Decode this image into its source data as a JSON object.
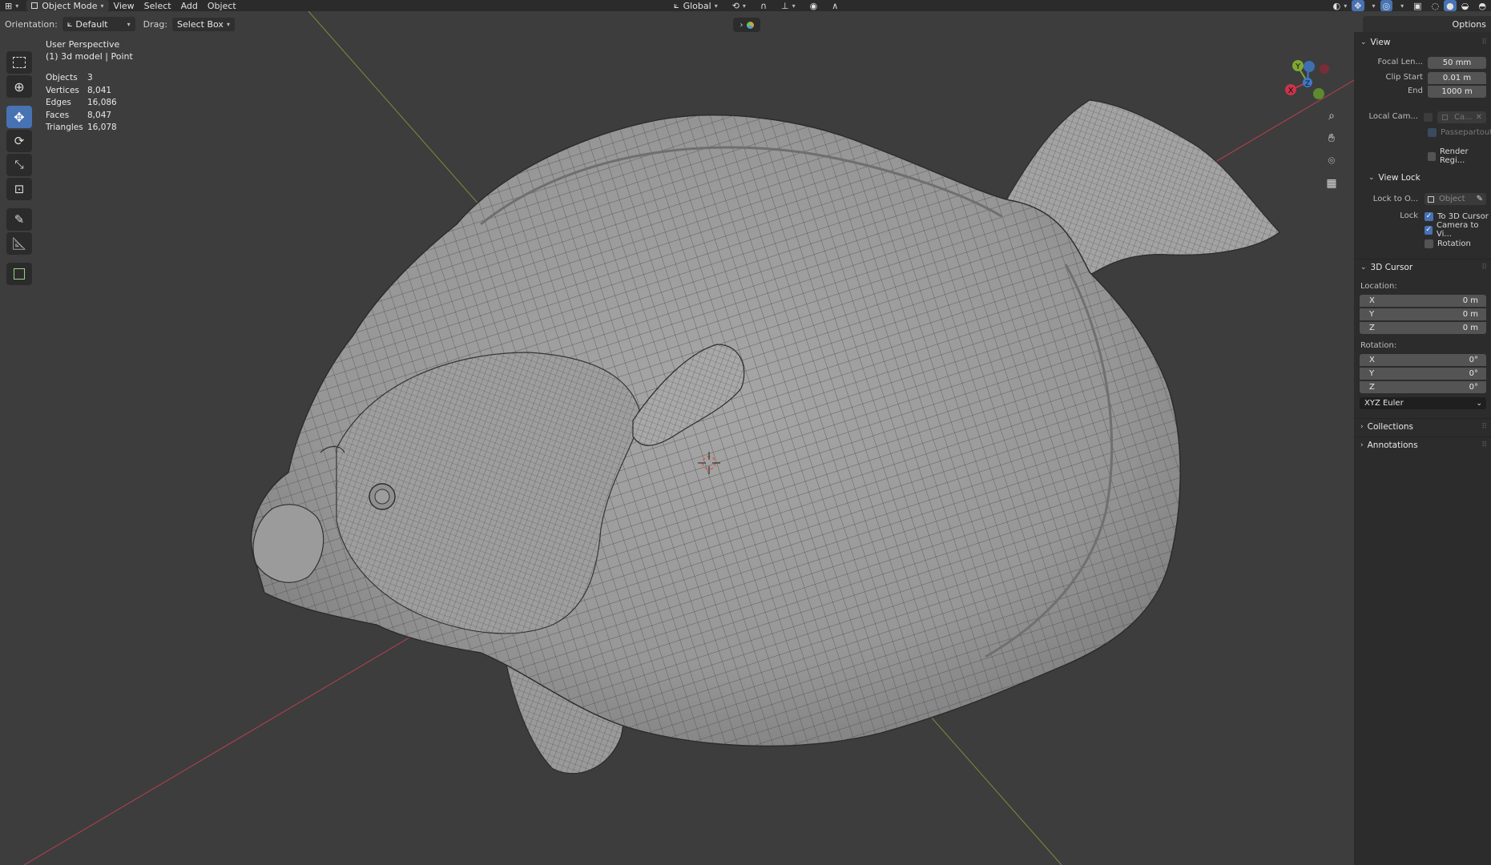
{
  "header": {
    "mode": "Object Mode",
    "menus": [
      "View",
      "Select",
      "Add",
      "Object"
    ],
    "transform_orientation": "Global"
  },
  "tool_options": {
    "orientation_label": "Orientation:",
    "orientation_value": "Default",
    "drag_label": "Drag:",
    "drag_value": "Select Box",
    "options_label": "Options"
  },
  "overlay": {
    "view_name": "User Perspective",
    "object_info": "(1) 3d model | Point",
    "stats": [
      {
        "label": "Objects",
        "value": "3"
      },
      {
        "label": "Vertices",
        "value": "8,041"
      },
      {
        "label": "Edges",
        "value": "16,086"
      },
      {
        "label": "Faces",
        "value": "8,047"
      },
      {
        "label": "Triangles",
        "value": "16,078"
      }
    ]
  },
  "gizmo": {
    "x": "X",
    "y": "Y",
    "z": "Z"
  },
  "panel": {
    "view_section": "View",
    "focal_length_label": "Focal Len...",
    "focal_length_value": "50 mm",
    "clip_start_label": "Clip Start",
    "clip_start_value": "0.01 m",
    "clip_end_label": "End",
    "clip_end_value": "1000 m",
    "local_camera_label": "Local Cam...",
    "local_camera_value": "Ca...",
    "passepartout_label": "Passepartout",
    "render_region_label": "Render Regi...",
    "view_lock_section": "View Lock",
    "lock_to_object_label": "Lock to O...",
    "lock_to_object_placeholder": "Object",
    "lock_label": "Lock",
    "lock_to_cursor_label": "To 3D Cursor",
    "lock_camera_label": "Camera to Vi...",
    "lock_rotation_label": "Rotation",
    "cursor_section": "3D Cursor",
    "location_label": "Location:",
    "location": [
      {
        "axis": "X",
        "value": "0 m"
      },
      {
        "axis": "Y",
        "value": "0 m"
      },
      {
        "axis": "Z",
        "value": "0 m"
      }
    ],
    "rotation_label": "Rotation:",
    "rotation": [
      {
        "axis": "X",
        "value": "0°"
      },
      {
        "axis": "Y",
        "value": "0°"
      },
      {
        "axis": "Z",
        "value": "0°"
      }
    ],
    "rotation_mode": "XYZ Euler",
    "collections_section": "Collections",
    "annotations_section": "Annotations"
  },
  "colors": {
    "accent": "#4772b3",
    "x_axis": "#c8344a",
    "y_axis": "#7fa834",
    "z_axis": "#3f7ac8",
    "mesh": "#9c9c9c",
    "background": "#3d3d3d"
  }
}
